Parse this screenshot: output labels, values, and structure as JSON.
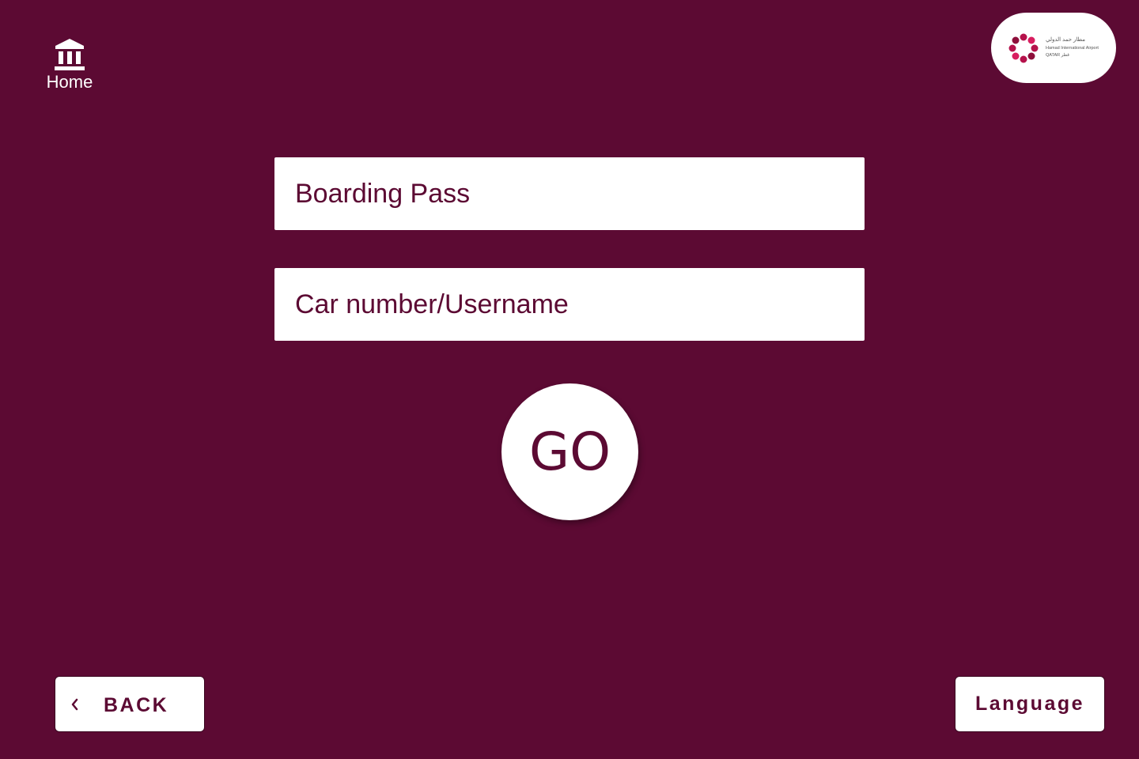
{
  "header": {
    "home_label": "Home",
    "home_icon": "bank-icon",
    "logo": {
      "name": "hamad-international-airport-logo",
      "text_arabic": "مطار حمد الدولي",
      "text_english": "Hamad International Airport",
      "text_country": "QATAR قطر"
    }
  },
  "form": {
    "boarding_pass": {
      "placeholder": "Boarding Pass",
      "value": ""
    },
    "car_number": {
      "placeholder": "Car number/Username",
      "value": ""
    },
    "go_label": "GO"
  },
  "footer": {
    "back_label": "BACK",
    "back_icon": "chevron-left-icon",
    "language_label": "Language"
  },
  "colors": {
    "background": "#5c0a33",
    "accent": "#5c0a33",
    "surface": "#ffffff"
  }
}
